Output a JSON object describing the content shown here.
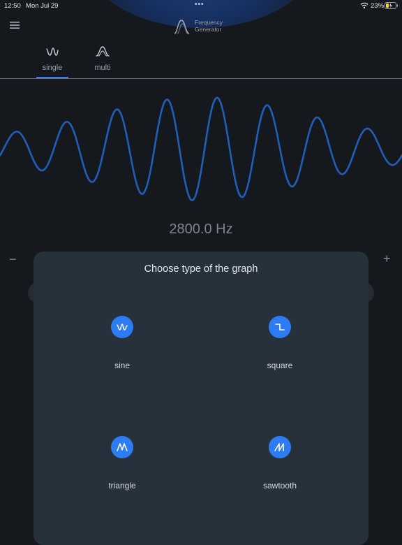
{
  "status_bar": {
    "time": "12:50",
    "date": "Mon Jul 29",
    "more_dots": "•••",
    "battery_percent": "23%"
  },
  "app": {
    "logo_line1": "Frequency",
    "logo_line2": "Generator"
  },
  "tabs": [
    {
      "label": "single",
      "selected": true,
      "icon": "sine-wave-icon"
    },
    {
      "label": "multi",
      "selected": false,
      "icon": "multi-wave-icon"
    }
  ],
  "frequency": {
    "display": "2800.0 Hz",
    "minus": "−",
    "plus": "+"
  },
  "sheet": {
    "title": "Choose type of the graph",
    "options": [
      {
        "label": "sine",
        "icon": "sine-wave-icon"
      },
      {
        "label": "square",
        "icon": "square-wave-icon"
      },
      {
        "label": "triangle",
        "icon": "triangle-wave-icon"
      },
      {
        "label": "sawtooth",
        "icon": "sawtooth-wave-icon"
      }
    ]
  },
  "colors": {
    "background": "#15181d",
    "accent": "#2d7cf3",
    "wave": "#1f5fb8",
    "sheet": "#27313b"
  }
}
